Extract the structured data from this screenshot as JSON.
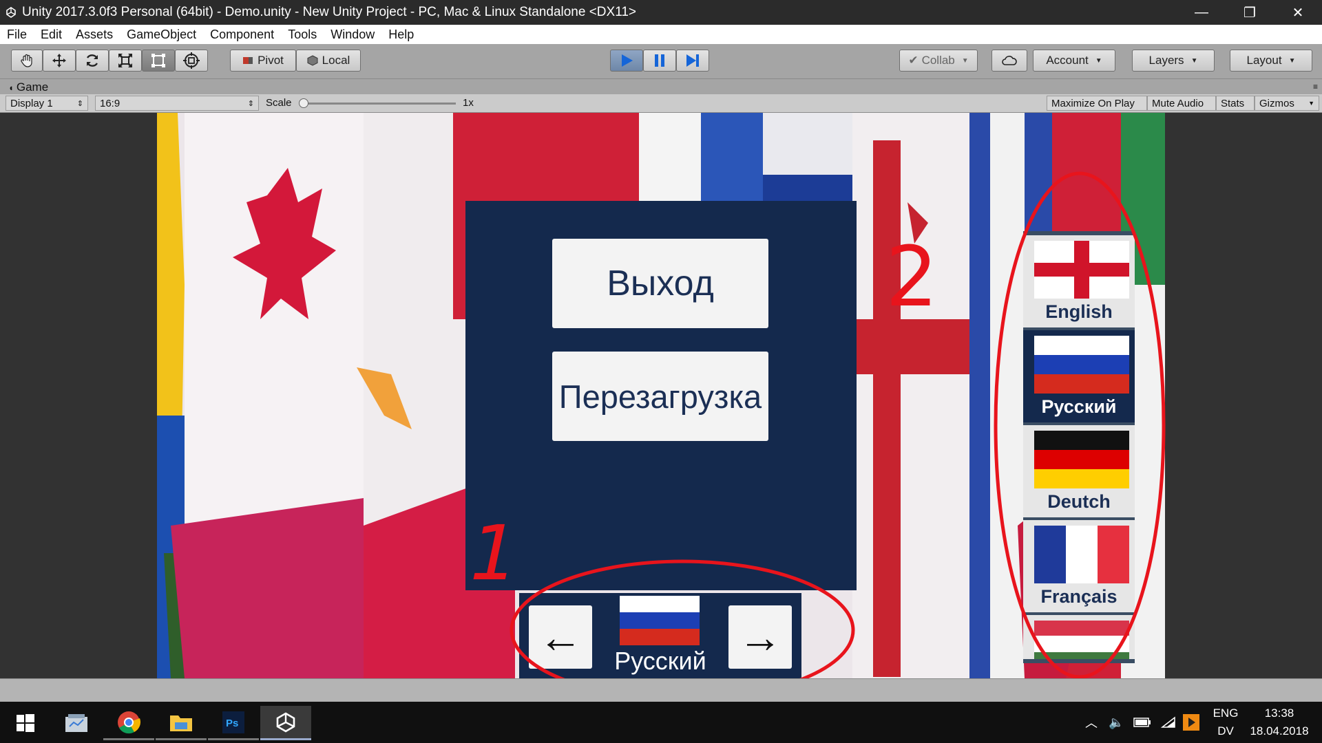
{
  "window": {
    "title": "Unity 2017.3.0f3 Personal (64bit) - Demo.unity - New Unity Project - PC, Mac & Linux Standalone <DX11>",
    "minimize_glyph": "—",
    "restore_glyph": "❐",
    "close_glyph": "✕"
  },
  "menu": [
    "File",
    "Edit",
    "Assets",
    "GameObject",
    "Component",
    "Tools",
    "Window",
    "Help"
  ],
  "toolbar": {
    "tools": [
      "hand-icon",
      "move-icon",
      "rotate-icon",
      "scale-icon",
      "rect-icon",
      "transform-icon"
    ],
    "pivot_label": "Pivot",
    "local_label": "Local",
    "collab_label": "Collab",
    "account_label": "Account",
    "layers_label": "Layers",
    "layout_label": "Layout"
  },
  "game_view": {
    "tab_label": "Game",
    "display_label": "Display 1",
    "aspect_label": "16:9",
    "scale_label": "Scale",
    "scale_value": "1x",
    "scale_fraction": 0,
    "maximize_label": "Maximize On Play",
    "mute_label": "Mute Audio",
    "stats_label": "Stats",
    "gizmos_label": "Gizmos"
  },
  "game": {
    "exit_button": "Выход",
    "reload_button": "Перезагрузка",
    "selected_language": "Русский",
    "left_arrow": "←",
    "right_arrow": "→",
    "languages": [
      {
        "name": "English",
        "flag": "england"
      },
      {
        "name": "Русский",
        "flag": "russia"
      },
      {
        "name": "Deutch",
        "flag": "germany"
      },
      {
        "name": "Français",
        "flag": "france"
      },
      {
        "name": "",
        "flag": "hungary"
      }
    ]
  },
  "annotations": {
    "label_1": "1",
    "label_2": "2",
    "color": "#e8141c"
  },
  "taskbar": {
    "apps": [
      "windows-start-icon",
      "file-explorer-icon",
      "chrome-icon",
      "folder-icon",
      "photoshop-icon",
      "unity-icon"
    ],
    "lang_top": "ENG",
    "lang_bottom": "DV",
    "time": "13:38",
    "date": "18.04.2018"
  }
}
